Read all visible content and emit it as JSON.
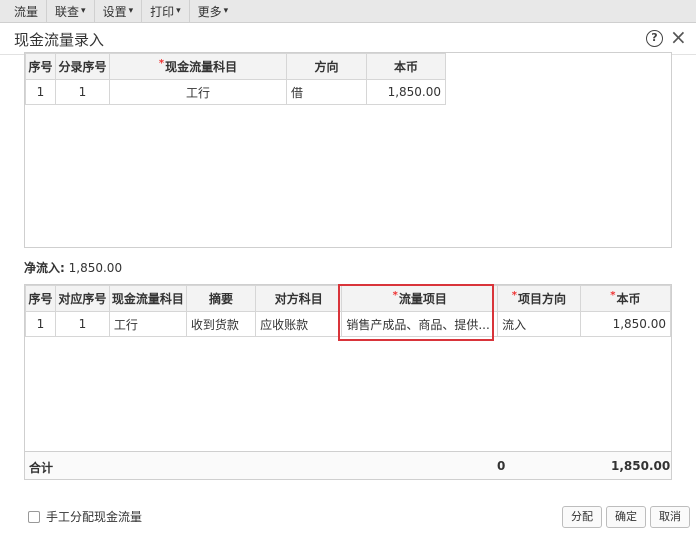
{
  "menu": {
    "items": [
      {
        "label": "流量",
        "has_caret": false
      },
      {
        "label": "联查",
        "has_caret": true
      },
      {
        "label": "设置",
        "has_caret": true
      },
      {
        "label": "打印",
        "has_caret": true
      },
      {
        "label": "更多",
        "has_caret": true
      }
    ],
    "caret": "▾"
  },
  "dialog": {
    "title": "现金流量录入",
    "help_glyph": "?",
    "close_glyph": "×"
  },
  "top_table": {
    "headers": {
      "seq": "序号",
      "entry_seq": "分录序号",
      "cash_subject": "现金流量科目",
      "direction": "方向",
      "currency": "本币"
    },
    "rows": [
      {
        "seq": "1",
        "entry_seq": "1",
        "cash_subject": "工行",
        "direction": "借",
        "currency": "1,850.00"
      }
    ]
  },
  "net_inflow": {
    "label": "净流入:",
    "value": "1,850.00"
  },
  "bottom_table": {
    "headers": {
      "seq": "序号",
      "ref_seq": "对应序号",
      "cash_subject": "现金流量科目",
      "summary": "摘要",
      "counter_subject": "对方科目",
      "flow_item": "流量项目",
      "item_direction": "项目方向",
      "currency": "本币"
    },
    "rows": [
      {
        "seq": "1",
        "ref_seq": "1",
        "cash_subject": "工行",
        "summary": "收到货款",
        "counter_subject": "应收账款",
        "flow_item": "销售产成品、商品、提供...",
        "item_direction": "流入",
        "currency": "1,850.00"
      }
    ],
    "total": {
      "label": "合计",
      "direction_total": "0",
      "currency_total": "1,850.00"
    }
  },
  "footer": {
    "manual_allocate_label": "手工分配现金流量",
    "allocate_button": "分配",
    "confirm_button": "确定",
    "cancel_button": "取消"
  },
  "required_mark": "*",
  "highlight_color": "#d9343a"
}
